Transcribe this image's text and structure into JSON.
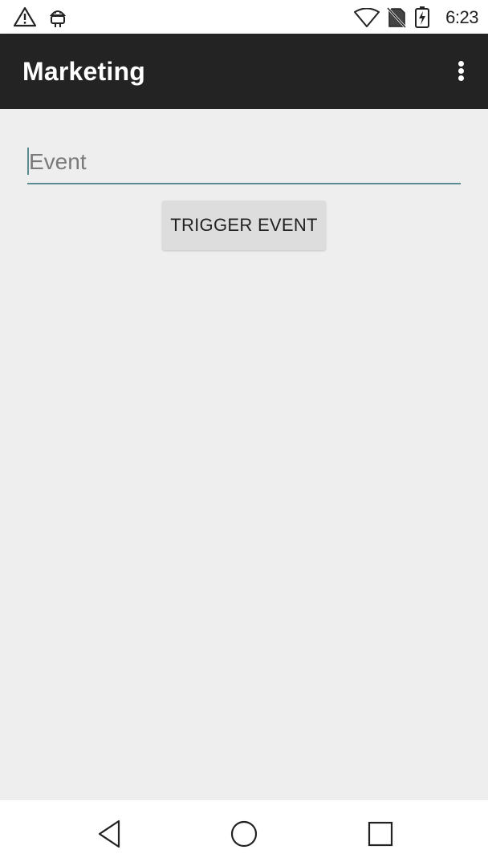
{
  "status_bar": {
    "time": "6:23",
    "icons": [
      "warning-icon",
      "android-debug-icon",
      "wifi-icon",
      "no-sim-icon",
      "battery-charging-icon"
    ]
  },
  "app_bar": {
    "title": "Marketing",
    "overflow_icon": "more-vert-icon"
  },
  "form": {
    "event_input": {
      "value": "",
      "placeholder": "Event"
    },
    "trigger_button_label": "TRIGGER EVENT"
  },
  "nav_bar": {
    "icons": [
      "back-icon",
      "home-icon",
      "recents-icon"
    ]
  },
  "colors": {
    "app_bar": "#232323",
    "background": "#efeeef",
    "accent_underline": "#5c8a92",
    "button": "#dedddd"
  }
}
